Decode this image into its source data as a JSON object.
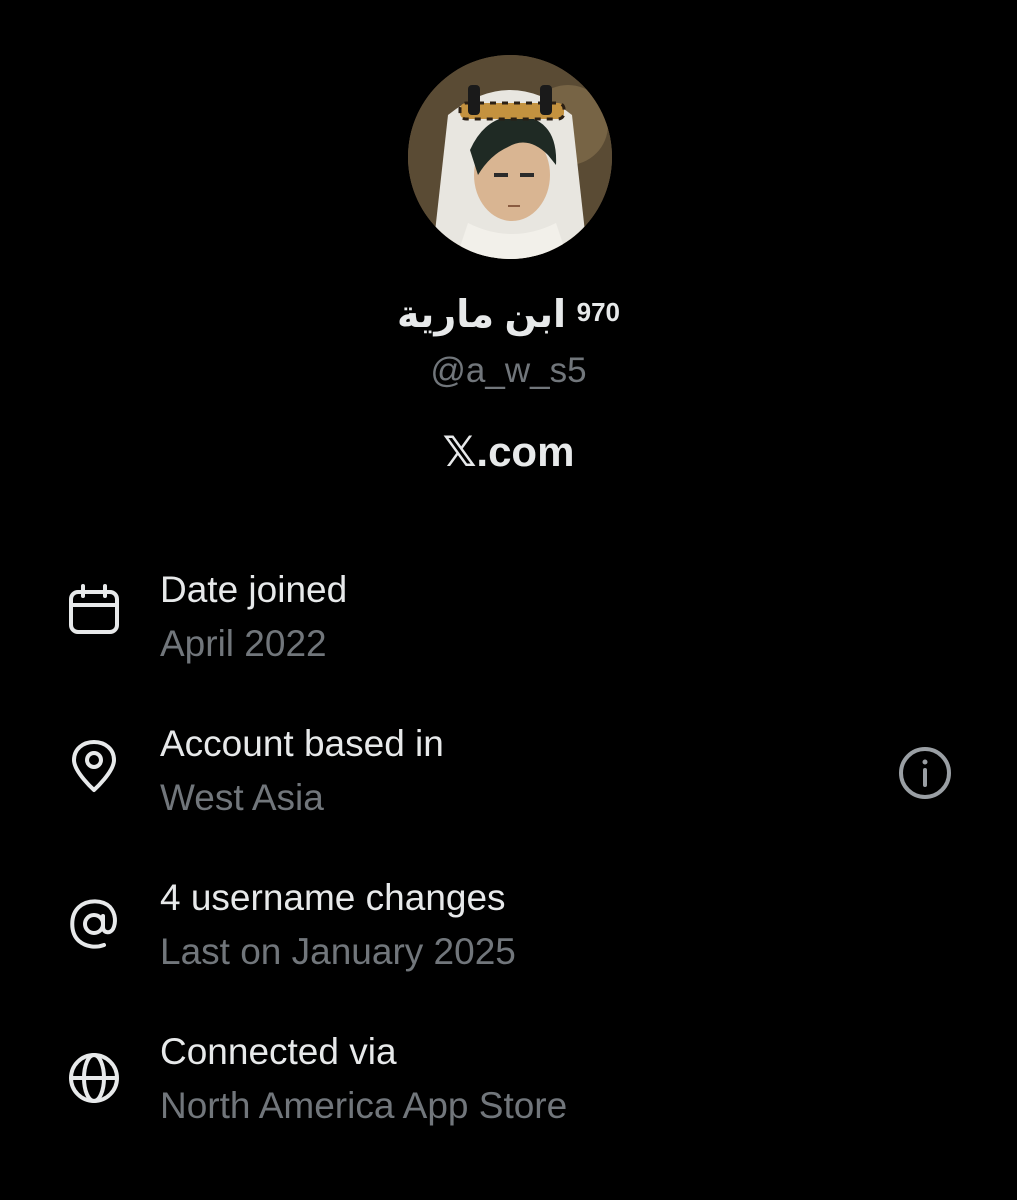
{
  "profile": {
    "display_name": "ابن مارية",
    "display_name_suffix": "970",
    "handle": "@a_w_s5",
    "site": "𝕏.com"
  },
  "about": {
    "items": [
      {
        "icon": "calendar-icon",
        "label": "Date joined",
        "value": "April 2022"
      },
      {
        "icon": "location-pin-icon",
        "label": "Account based in",
        "value": "West Asia"
      },
      {
        "icon": "at-sign-icon",
        "label": "4 username changes",
        "value": "Last on January 2025"
      },
      {
        "icon": "globe-icon",
        "label": "Connected via",
        "value": "North America App Store"
      }
    ],
    "info_icon": "info-icon"
  },
  "colors": {
    "background": "#000000",
    "primary_text": "#e7e9ea",
    "secondary_text": "#71767b",
    "icon": "#e7e9ea"
  }
}
